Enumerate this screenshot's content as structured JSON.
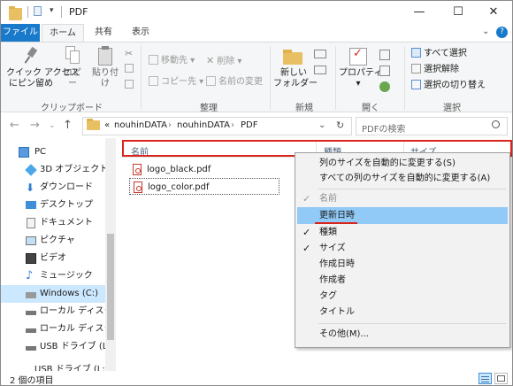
{
  "window": {
    "title": "PDF",
    "minimize_glyph": "—",
    "maximize_glyph": "☐",
    "close_glyph": "✕"
  },
  "tabs": [
    {
      "label": "ファイル"
    },
    {
      "label": "ホーム"
    },
    {
      "label": "共有"
    },
    {
      "label": "表示"
    }
  ],
  "ribbon": {
    "quick_access_label": "クイック アクセス\nにピン留め",
    "copy_label": "コピー",
    "paste_label": "貼り付け",
    "move_to_label": "移動先 ▾",
    "copy_to_label": "コピー先 ▾",
    "delete_label": "削除 ▾",
    "rename_label": "名前の変更",
    "new_folder_label": "新しい\nフォルダー",
    "properties_label": "プロパティ\n▾",
    "select_all_label": "すべて選択",
    "select_none_label": "選択解除",
    "invert_selection_label": "選択の切り替え",
    "groups": {
      "clipboard": "クリップボード",
      "organize": "整理",
      "new": "新規",
      "open": "開く",
      "select": "選択"
    }
  },
  "address": {
    "path": [
      "nouhinDATA",
      "nouhinDATA",
      "PDF"
    ],
    "prefix": "«",
    "separator": "›",
    "search_placeholder": "PDFの検索"
  },
  "nav_pane": {
    "items": [
      {
        "label": "PC",
        "icon": "pc-icon"
      },
      {
        "label": "3D オブジェクト",
        "icon": "3d-objects-icon"
      },
      {
        "label": "ダウンロード",
        "icon": "download-icon"
      },
      {
        "label": "デスクトップ",
        "icon": "desktop-icon"
      },
      {
        "label": "ドキュメント",
        "icon": "documents-icon"
      },
      {
        "label": "ピクチャ",
        "icon": "pictures-icon"
      },
      {
        "label": "ビデオ",
        "icon": "videos-icon"
      },
      {
        "label": "ミュージック",
        "icon": "music-icon"
      },
      {
        "label": "Windows (C:)",
        "icon": "drive-icon"
      },
      {
        "label": "ローカル ディスク (D",
        "icon": "drive-icon"
      },
      {
        "label": "ローカル ディスク (E",
        "icon": "drive-icon"
      },
      {
        "label": "USB ドライブ (L:)",
        "icon": "usb-drive-icon"
      },
      {
        "label": "USB ドライブ (L:)",
        "icon": "usb-drive-icon"
      }
    ]
  },
  "columns": {
    "name": "名前",
    "type": "種類",
    "size": "サイズ"
  },
  "files": [
    {
      "name": "logo_black.pdf"
    },
    {
      "name": "logo_color.pdf"
    }
  ],
  "context_menu": {
    "items": [
      {
        "label": "列のサイズを自動的に変更する(S)",
        "checked": false
      },
      {
        "label": "すべての列のサイズを自動的に変更する(A)",
        "checked": false
      },
      {
        "label": "名前",
        "checked": true
      },
      {
        "label": "更新日時",
        "checked": false
      },
      {
        "label": "種類",
        "checked": true
      },
      {
        "label": "サイズ",
        "checked": true
      },
      {
        "label": "作成日時",
        "checked": false
      },
      {
        "label": "作成者",
        "checked": false
      },
      {
        "label": "タグ",
        "checked": false
      },
      {
        "label": "タイトル",
        "checked": false
      },
      {
        "label": "その他(M)...",
        "checked": false
      }
    ],
    "check_glyph": "✓"
  },
  "status": {
    "item_count": "2 個の項目"
  },
  "colors": {
    "file_tab": "#1979ca",
    "highlight": "#91c9f7",
    "annotation_red": "#d9251c",
    "selected_nav": "#cce8ff"
  }
}
